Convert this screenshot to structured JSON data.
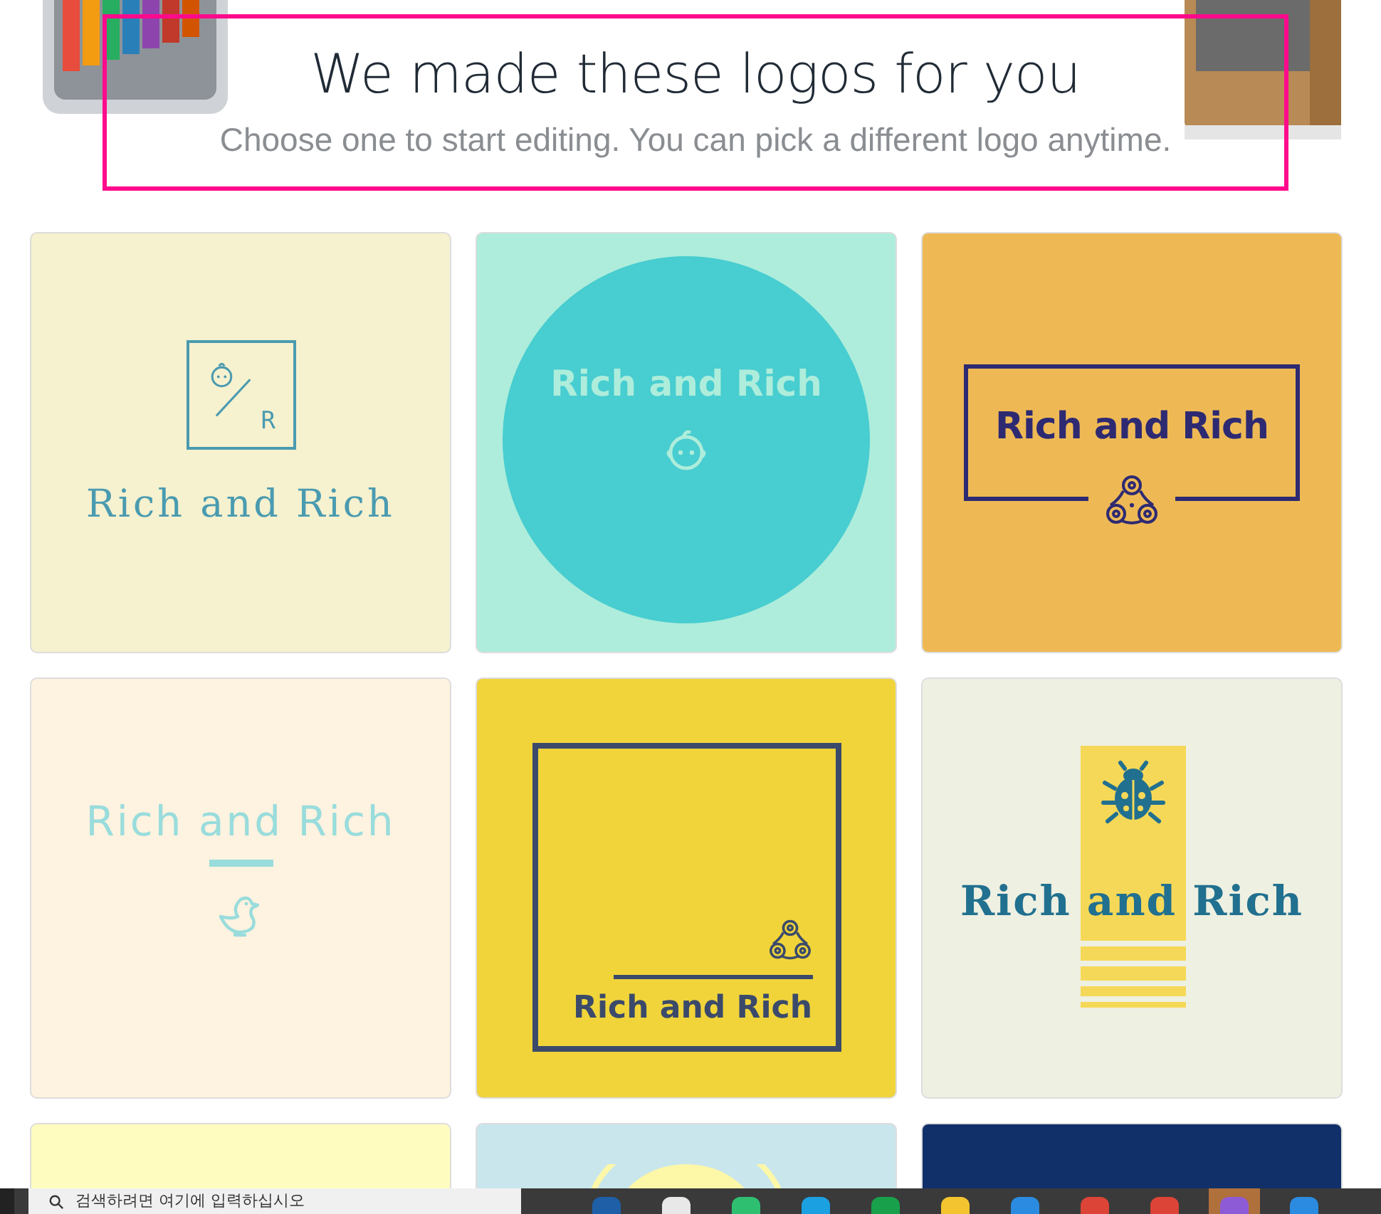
{
  "header": {
    "title": "We made these logos for you",
    "subtitle": "Choose one to start editing. You can pick a different logo anytime.",
    "highlighted": true
  },
  "logos": [
    {
      "kind": "monogram-box",
      "name": "Rich and Rich",
      "monogram": "R"
    },
    {
      "kind": "circle",
      "name": "Rich and Rich"
    },
    {
      "kind": "frame",
      "name": "Rich and Rich"
    },
    {
      "kind": "duck",
      "name": "Rich and Rich"
    },
    {
      "kind": "square-frame",
      "name": "Rich and Rich"
    },
    {
      "kind": "ladybug",
      "name": "Rich and Rich"
    },
    {
      "kind": "plain-yellow"
    },
    {
      "kind": "sun"
    },
    {
      "kind": "navy"
    }
  ],
  "taskbar": {
    "search_placeholder": "검색하려면 여기에 입력하십시오"
  }
}
